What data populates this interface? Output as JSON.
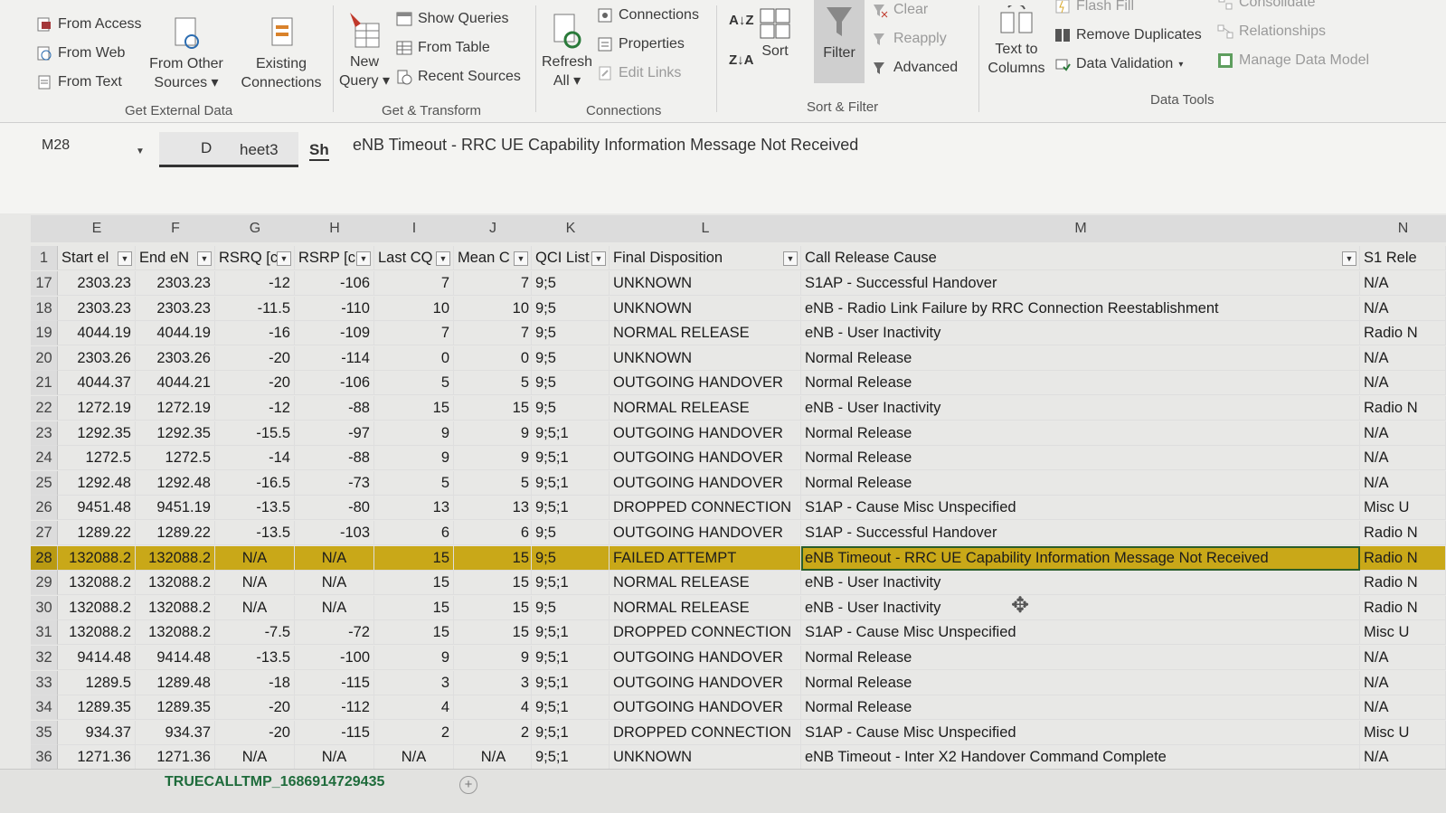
{
  "ribbon": {
    "from_access": "From Access",
    "from_web": "From Web",
    "from_text": "From Text",
    "from_other_sources": [
      "From Other",
      "Sources ▾"
    ],
    "existing_connections": [
      "Existing",
      "Connections"
    ],
    "new_query": [
      "New",
      "Query ▾"
    ],
    "show_queries": "Show Queries",
    "from_table": "From Table",
    "recent_sources": "Recent Sources",
    "refresh_all": [
      "Refresh",
      "All ▾"
    ],
    "connections": "Connections",
    "properties": "Properties",
    "edit_links": "Edit Links",
    "sort": "Sort",
    "filter": "Filter",
    "clear": "Clear",
    "reapply": "Reapply",
    "advanced": "Advanced",
    "text_to_columns": [
      "Text to",
      "Columns"
    ],
    "flash_fill": "Flash Fill",
    "remove_duplicates": "Remove Duplicates",
    "data_validation": "Data Validation",
    "consolidate": "Consolidate",
    "relationships": "Relationships",
    "manage_data_model": "Manage Data Model",
    "groups": {
      "get_external_data": "Get External Data",
      "get_transform": "Get & Transform",
      "connections": "Connections",
      "sort_filter": "Sort & Filter",
      "data_tools": "Data Tools"
    }
  },
  "formula_bar": {
    "name_box": "M28",
    "tab_d": "D",
    "tab_sheet3": "heet3",
    "tab_sh": "Sh",
    "content": "eNB Timeout - RRC UE Capability Information Message Not Received"
  },
  "columns": [
    "E",
    "F",
    "G",
    "H",
    "I",
    "J",
    "K",
    "L",
    "M",
    "N"
  ],
  "headers": [
    "Start el",
    "End eN",
    "RSRQ [c",
    "RSRP [c",
    "Last CQ",
    "Mean C",
    "QCI List",
    "Final Disposition",
    "Call Release Cause",
    "S1 Rele"
  ],
  "rows": [
    {
      "n": "17",
      "e": "2303.23",
      "f": "2303.23",
      "g": "-12",
      "h": "-106",
      "i": "7",
      "j": "7",
      "k": "9;5",
      "l": "UNKNOWN",
      "m": "S1AP - Successful Handover",
      "s": "N/A"
    },
    {
      "n": "18",
      "e": "2303.23",
      "f": "2303.23",
      "g": "-11.5",
      "h": "-110",
      "i": "10",
      "j": "10",
      "k": "9;5",
      "l": "UNKNOWN",
      "m": "eNB - Radio Link Failure by RRC Connection Reestablishment",
      "s": "N/A"
    },
    {
      "n": "19",
      "e": "4044.19",
      "f": "4044.19",
      "g": "-16",
      "h": "-109",
      "i": "7",
      "j": "7",
      "k": "9;5",
      "l": "NORMAL RELEASE",
      "m": "eNB - User Inactivity",
      "s": "Radio N"
    },
    {
      "n": "20",
      "e": "2303.26",
      "f": "2303.26",
      "g": "-20",
      "h": "-114",
      "i": "0",
      "j": "0",
      "k": "9;5",
      "l": "UNKNOWN",
      "m": "Normal Release",
      "s": "N/A"
    },
    {
      "n": "21",
      "e": "4044.37",
      "f": "4044.21",
      "g": "-20",
      "h": "-106",
      "i": "5",
      "j": "5",
      "k": "9;5",
      "l": "OUTGOING HANDOVER",
      "m": "Normal Release",
      "s": "N/A"
    },
    {
      "n": "22",
      "e": "1272.19",
      "f": "1272.19",
      "g": "-12",
      "h": "-88",
      "i": "15",
      "j": "15",
      "k": "9;5",
      "l": "NORMAL RELEASE",
      "m": "eNB - User Inactivity",
      "s": "Radio N"
    },
    {
      "n": "23",
      "e": "1292.35",
      "f": "1292.35",
      "g": "-15.5",
      "h": "-97",
      "i": "9",
      "j": "9",
      "k": "9;5;1",
      "l": "OUTGOING HANDOVER",
      "m": "Normal Release",
      "s": "N/A"
    },
    {
      "n": "24",
      "e": "1272.5",
      "f": "1272.5",
      "g": "-14",
      "h": "-88",
      "i": "9",
      "j": "9",
      "k": "9;5;1",
      "l": "OUTGOING HANDOVER",
      "m": "Normal Release",
      "s": "N/A"
    },
    {
      "n": "25",
      "e": "1292.48",
      "f": "1292.48",
      "g": "-16.5",
      "h": "-73",
      "i": "5",
      "j": "5",
      "k": "9;5;1",
      "l": "OUTGOING HANDOVER",
      "m": "Normal Release",
      "s": "N/A"
    },
    {
      "n": "26",
      "e": "9451.48",
      "f": "9451.19",
      "g": "-13.5",
      "h": "-80",
      "i": "13",
      "j": "13",
      "k": "9;5;1",
      "l": "DROPPED CONNECTION",
      "m": "S1AP - Cause Misc Unspecified",
      "s": "Misc U"
    },
    {
      "n": "27",
      "e": "1289.22",
      "f": "1289.22",
      "g": "-13.5",
      "h": "-103",
      "i": "6",
      "j": "6",
      "k": "9;5",
      "l": "OUTGOING HANDOVER",
      "m": "S1AP - Successful Handover",
      "s": "Radio N"
    },
    {
      "n": "28",
      "e": "132088.2",
      "f": "132088.2",
      "g": "N/A",
      "h": "N/A",
      "i": "15",
      "j": "15",
      "k": "9;5",
      "l": "FAILED ATTEMPT",
      "m": "eNB Timeout - RRC UE Capability Information Message Not Received",
      "s": "Radio N",
      "highlight": true
    },
    {
      "n": "29",
      "e": "132088.2",
      "f": "132088.2",
      "g": "N/A",
      "h": "N/A",
      "i": "15",
      "j": "15",
      "k": "9;5;1",
      "l": "NORMAL RELEASE",
      "m": "eNB - User Inactivity",
      "s": "Radio N"
    },
    {
      "n": "30",
      "e": "132088.2",
      "f": "132088.2",
      "g": "N/A",
      "h": "N/A",
      "i": "15",
      "j": "15",
      "k": "9;5",
      "l": "NORMAL RELEASE",
      "m": "eNB - User Inactivity",
      "s": "Radio N"
    },
    {
      "n": "31",
      "e": "132088.2",
      "f": "132088.2",
      "g": "-7.5",
      "h": "-72",
      "i": "15",
      "j": "15",
      "k": "9;5;1",
      "l": "DROPPED CONNECTION",
      "m": "S1AP - Cause Misc Unspecified",
      "s": "Misc U"
    },
    {
      "n": "32",
      "e": "9414.48",
      "f": "9414.48",
      "g": "-13.5",
      "h": "-100",
      "i": "9",
      "j": "9",
      "k": "9;5;1",
      "l": "OUTGOING HANDOVER",
      "m": "Normal Release",
      "s": "N/A"
    },
    {
      "n": "33",
      "e": "1289.5",
      "f": "1289.48",
      "g": "-18",
      "h": "-115",
      "i": "3",
      "j": "3",
      "k": "9;5;1",
      "l": "OUTGOING HANDOVER",
      "m": "Normal Release",
      "s": "N/A"
    },
    {
      "n": "34",
      "e": "1289.35",
      "f": "1289.35",
      "g": "-20",
      "h": "-112",
      "i": "4",
      "j": "4",
      "k": "9;5;1",
      "l": "OUTGOING HANDOVER",
      "m": "Normal Release",
      "s": "N/A"
    },
    {
      "n": "35",
      "e": "934.37",
      "f": "934.37",
      "g": "-20",
      "h": "-115",
      "i": "2",
      "j": "2",
      "k": "9;5;1",
      "l": "DROPPED CONNECTION",
      "m": "S1AP - Cause Misc Unspecified",
      "s": "Misc U"
    },
    {
      "n": "36",
      "e": "1271.36",
      "f": "1271.36",
      "g": "N/A",
      "h": "N/A",
      "i": "N/A",
      "j": "N/A",
      "k": "9;5;1",
      "l": "UNKNOWN",
      "m": "eNB Timeout - Inter X2 Handover Command Complete",
      "s": "N/A"
    }
  ],
  "sheet_tab": "TRUECALLTMP_1686914729435",
  "add_sheet": "+",
  "colors": {
    "highlight": "#c9a818",
    "selection_border": "#2a5d2a",
    "sheet_tab_text": "#1e6b3b"
  }
}
